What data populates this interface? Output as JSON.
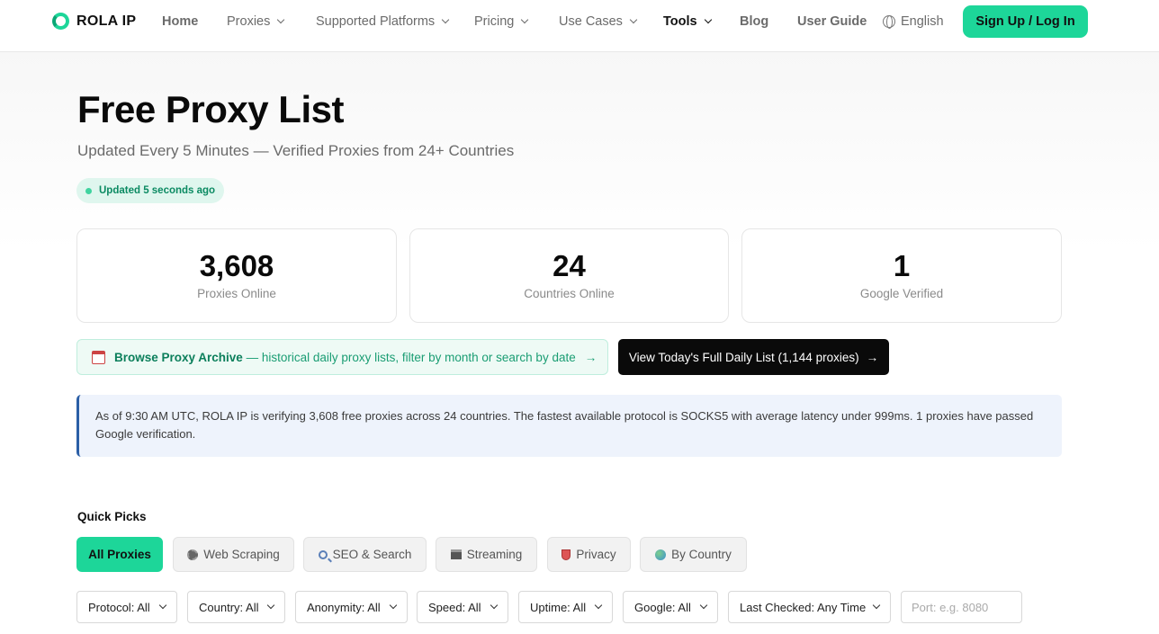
{
  "brand": {
    "name": "ROLA IP"
  },
  "nav": {
    "items": [
      {
        "label": "Home",
        "dropdown": false
      },
      {
        "label": "Proxies",
        "dropdown": true
      },
      {
        "label": "Supported Platforms",
        "dropdown": true
      },
      {
        "label": "Pricing",
        "dropdown": true
      },
      {
        "label": "Use Cases",
        "dropdown": true
      },
      {
        "label": "Tools",
        "dropdown": true
      },
      {
        "label": "Blog",
        "dropdown": false
      },
      {
        "label": "User Guide",
        "dropdown": false
      }
    ],
    "language": "English",
    "signup": "Sign Up / Log In"
  },
  "hero": {
    "title": "Free Proxy List",
    "subtitle": "Updated Every 5 Minutes — Verified Proxies from 24+ Countries",
    "updated": "Updated 5 seconds ago"
  },
  "stats": [
    {
      "value": "3,608",
      "label": "Proxies Online"
    },
    {
      "value": "24",
      "label": "Countries Online"
    },
    {
      "value": "1",
      "label": "Google Verified"
    }
  ],
  "archive": {
    "title": "Browse Proxy Archive",
    "description": "— historical daily proxy lists, filter by month or search by date",
    "arrow": "→"
  },
  "daily_button": {
    "label": "View Today's Full Daily List (1,144 proxies)",
    "arrow": "→"
  },
  "info": {
    "text": "As of 9:30 AM UTC, ROLA IP is verifying 3,608 free proxies across 24 countries. The fastest available protocol is SOCKS5 with average latency under 999ms. 1 proxies have passed Google verification."
  },
  "quick_picks": {
    "title": "Quick Picks",
    "chips": [
      {
        "label": "All Proxies",
        "icon": "",
        "active": true
      },
      {
        "label": "Web Scraping",
        "icon": "gear-icon",
        "active": false
      },
      {
        "label": "SEO & Search",
        "icon": "search-icon",
        "active": false
      },
      {
        "label": "Streaming",
        "icon": "clapperboard-icon",
        "active": false
      },
      {
        "label": "Privacy",
        "icon": "shield-icon",
        "active": false
      },
      {
        "label": "By Country",
        "icon": "globe-icon",
        "active": false
      }
    ]
  },
  "filters": {
    "selects": [
      {
        "label": "Protocol: All"
      },
      {
        "label": "Country: All"
      },
      {
        "label": "Anonymity: All"
      },
      {
        "label": "Speed: All"
      },
      {
        "label": "Uptime: All"
      },
      {
        "label": "Google: All"
      },
      {
        "label": "Last Checked: Any Time"
      }
    ],
    "port_placeholder": "Port: e.g. 8080"
  },
  "colors": {
    "accent": "#1dd699",
    "info_border": "#2b5fa6",
    "info_bg": "#eef3fc"
  }
}
